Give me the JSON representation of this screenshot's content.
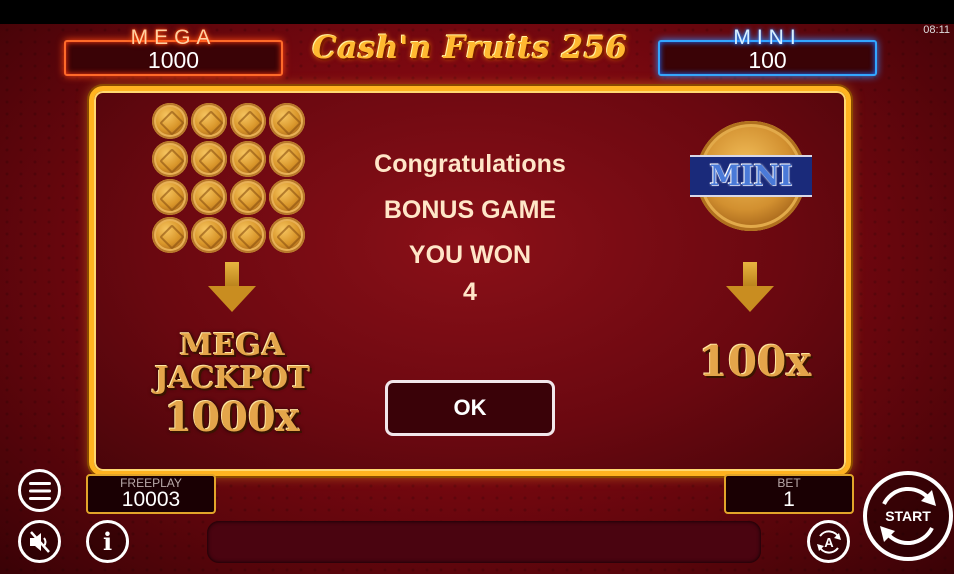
{
  "header": {
    "title": "Cash'n Fruits 256",
    "clock": "08:11",
    "mega_jackpot": {
      "label": "MEGA",
      "value": "1000"
    },
    "mini_jackpot": {
      "label": "MINI",
      "value": "100"
    }
  },
  "dialog": {
    "line1": "Congratulations",
    "line2": "BONUS GAME",
    "line3": "YOU WON",
    "line4": "4",
    "ok_label": "OK",
    "mega_prize": {
      "line1": "MEGA",
      "line2": "JACKPOT",
      "line3": "1000x"
    },
    "mini_prize": {
      "coin_label": "MINI",
      "multiplier": "100x"
    },
    "coin_count": 16
  },
  "footer": {
    "freeplay_label": "FREEPLAY",
    "freeplay_value": "10003",
    "bet_label": "BET",
    "bet_value": "1",
    "start_label": "START",
    "auto_label": "A",
    "info_label": "i"
  },
  "colors": {
    "background": "#7a0810",
    "mega_accent": "#ff6a2a",
    "mini_accent": "#33a6ff",
    "frame_gold": "#ffb320"
  }
}
